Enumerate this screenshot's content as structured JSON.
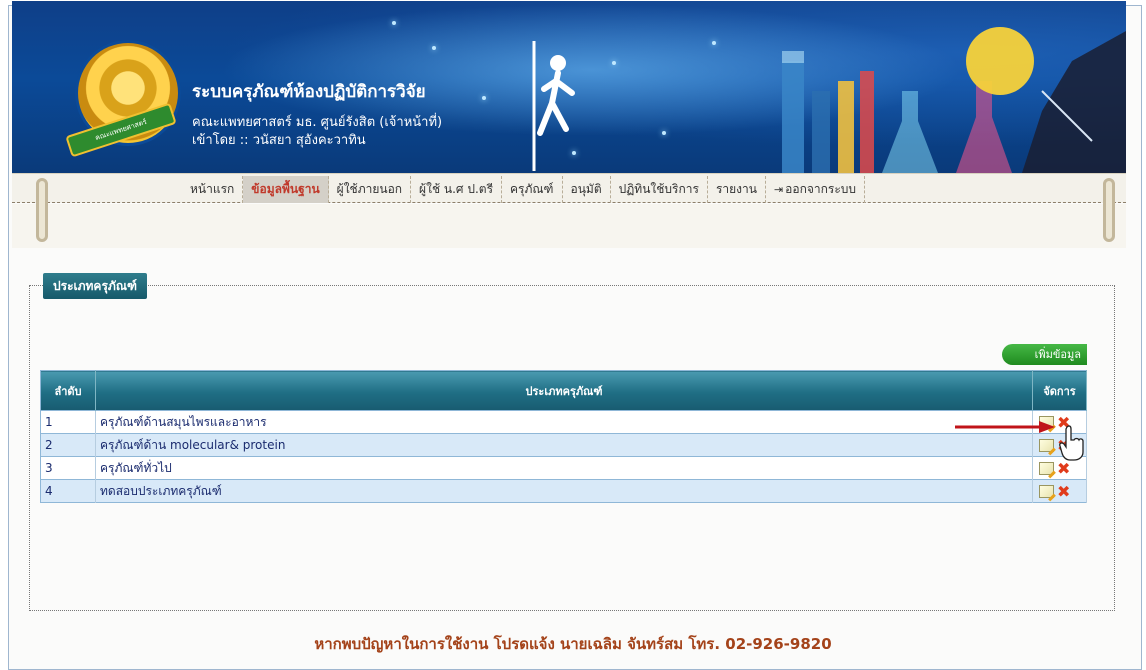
{
  "header": {
    "system_title": "ระบบครุภัณฑ์ห้องปฏิบัติการวิจัย",
    "subtitle": "คณะแพทยศาสตร์ มธ. ศูนย์รังสิต (เจ้าหน้าที่)",
    "user_line": "เข้าโดย :: วนัสยา สุอังคะวาทิน",
    "logo_text": "คณะแพทยศาสตร์"
  },
  "nav": {
    "items": [
      {
        "label": "หน้าแรก"
      },
      {
        "label": "ข้อมูลพื้นฐาน"
      },
      {
        "label": "ผู้ใช้ภายนอก"
      },
      {
        "label": "ผู้ใช้ น.ศ ป.ตรี"
      },
      {
        "label": "ครุภัณฑ์"
      },
      {
        "label": "อนุมัติ"
      },
      {
        "label": "ปฏิทินใช้บริการ"
      },
      {
        "label": "รายงาน"
      },
      {
        "label": "ออกจากระบบ"
      }
    ],
    "active_index": 1
  },
  "section": {
    "legend": "ประเภทครุภัณฑ์",
    "add_button": "เพิ่มข้อมูล"
  },
  "table": {
    "headers": [
      "ลำดับ",
      "ประเภทครุภัณฑ์",
      "จัดการ"
    ],
    "rows": [
      {
        "no": "1",
        "name": "ครุภัณฑ์ด้านสมุนไพรและอาหาร"
      },
      {
        "no": "2",
        "name": "ครุภัณฑ์ด้าน molecular& protein"
      },
      {
        "no": "3",
        "name": "ครุภัณฑ์ทั่วไป"
      },
      {
        "no": "4",
        "name": "ทดสอบประเภทครุภัณฑ์"
      }
    ]
  },
  "footer": {
    "text": "หากพบปัญหาในการใช้งาน โปรดแจ้ง นายเฉลิม จันทร์สม โทร. 02-926-9820"
  },
  "colors": {
    "banner_blue": "#0b4a98",
    "active_nav_text": "#c0392b",
    "table_header": "#1f6e84",
    "row_alt": "#d8e9f8",
    "add_button": "#1f8b1f",
    "footer_text": "#a4431a",
    "arrow": "#c0141a"
  },
  "icons": {
    "edit": "edit-icon",
    "delete": "delete-icon",
    "logout": "logout-icon"
  }
}
